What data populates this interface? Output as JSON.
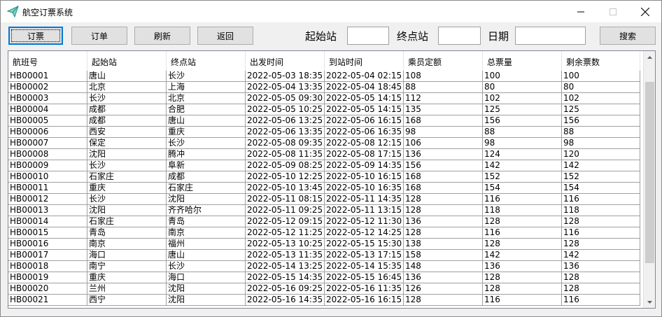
{
  "window": {
    "title": "航空订票系统"
  },
  "toolbar": {
    "book_label": "订票",
    "orders_label": "订单",
    "refresh_label": "刷新",
    "back_label": "返回",
    "from_label": "起始站",
    "from_value": "",
    "to_label": "终点站",
    "to_value": "",
    "date_label": "日期",
    "date_value": "",
    "search_label": "搜索"
  },
  "table": {
    "columns": [
      "航班号",
      "起始站",
      "终点站",
      "出发时间",
      "到站时间",
      "乘员定额",
      "总票量",
      "剩余票数"
    ],
    "rows": [
      [
        "HB00001",
        "唐山",
        "长沙",
        "2022-05-03 18:35",
        "2022-05-04 02:15",
        "108",
        "100",
        "100"
      ],
      [
        "HB00002",
        "北京",
        "上海",
        "2022-05-04 13:35",
        "2022-05-04 18:45",
        "88",
        "80",
        "80"
      ],
      [
        "HB00003",
        "长沙",
        "北京",
        "2022-05-05 09:30",
        "2022-05-05 14:15",
        "112",
        "102",
        "102"
      ],
      [
        "HB00004",
        "成都",
        "合肥",
        "2022-05-05 10:25",
        "2022-05-05 14:15",
        "135",
        "125",
        "125"
      ],
      [
        "HB00005",
        "成都",
        "唐山",
        "2022-05-06 13:25",
        "2022-05-06 16:15",
        "168",
        "156",
        "156"
      ],
      [
        "HB00006",
        "西安",
        "重庆",
        "2022-05-06 13:35",
        "2022-05-06 16:35",
        "98",
        "88",
        "88"
      ],
      [
        "HB00007",
        "保定",
        "长沙",
        "2022-05-08 09:35",
        "2022-05-08 12:15",
        "106",
        "98",
        "98"
      ],
      [
        "HB00008",
        "沈阳",
        "腾冲",
        "2022-05-08 11:35",
        "2022-05-08 17:15",
        "136",
        "124",
        "120"
      ],
      [
        "HB00009",
        "长沙",
        "阜新",
        "2022-05-09 08:25",
        "2022-05-09 14:35",
        "156",
        "142",
        "142"
      ],
      [
        "HB00010",
        "石家庄",
        "成都",
        "2022-05-10 12:25",
        "2022-05-10 16:15",
        "168",
        "152",
        "152"
      ],
      [
        "HB00011",
        "重庆",
        "石家庄",
        "2022-05-10 13:45",
        "2022-05-10 16:35",
        "168",
        "154",
        "154"
      ],
      [
        "HB00012",
        "长沙",
        "沈阳",
        "2022-05-11 08:15",
        "2022-05-11 14:35",
        "128",
        "116",
        "116"
      ],
      [
        "HB00013",
        "沈阳",
        "齐齐哈尔",
        "2022-05-11 09:25",
        "2022-05-11 13:15",
        "128",
        "118",
        "118"
      ],
      [
        "HB00014",
        "石家庄",
        "青岛",
        "2022-05-12 09:15",
        "2022-05-12 11:30",
        "136",
        "128",
        "128"
      ],
      [
        "HB00015",
        "青岛",
        "南京",
        "2022-05-12 11:25",
        "2022-05-12 14:25",
        "128",
        "116",
        "116"
      ],
      [
        "HB00016",
        "南京",
        "福州",
        "2022-05-13 10:25",
        "2022-05-15 15:30",
        "138",
        "128",
        "128"
      ],
      [
        "HB00017",
        "海口",
        "唐山",
        "2022-05-13 11:35",
        "2022-05-13 17:15",
        "158",
        "142",
        "142"
      ],
      [
        "HB00018",
        "南宁",
        "长沙",
        "2022-05-14 13:25",
        "2022-05-14 15:35",
        "148",
        "136",
        "136"
      ],
      [
        "HB00019",
        "重庆",
        "海口",
        "2022-05-15 14:35",
        "2022-05-15 16:45",
        "136",
        "128",
        "128"
      ],
      [
        "HB00020",
        "兰州",
        "沈阳",
        "2022-05-16 09:25",
        "2022-05-16 11:35",
        "126",
        "128",
        "128"
      ],
      [
        "HB00021",
        "西宁",
        "沈阳",
        "2022-05-16 14:35",
        "2022-05-16 16:15",
        "128",
        "116",
        "116"
      ]
    ]
  },
  "scrollbar": {
    "position_fraction": 0.08,
    "visible_fraction": 0.78
  },
  "colors": {
    "accent": "#0078d7",
    "window_bg": "#f0f0f0",
    "grid_line": "#a0a0a0"
  }
}
